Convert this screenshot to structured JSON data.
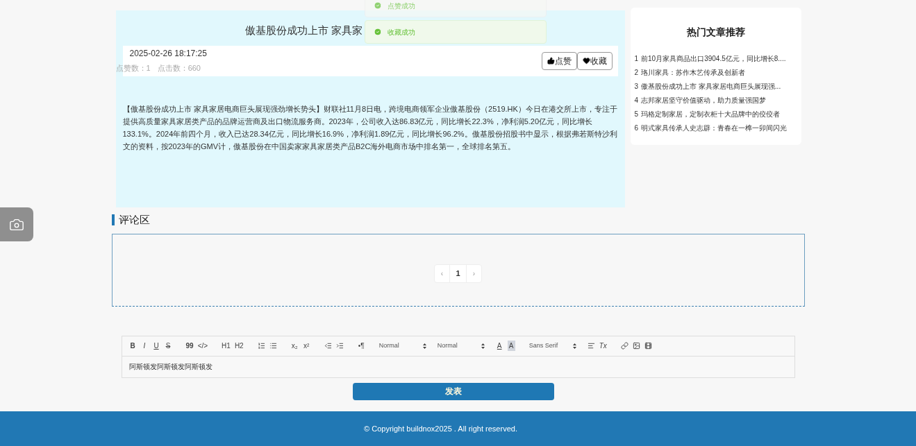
{
  "toasts": [
    {
      "text": "点赞成功",
      "faded": true
    },
    {
      "text": "收藏成功",
      "faded": false
    }
  ],
  "article": {
    "title": "傲基股份成功上市 家具家",
    "date": "2025-02-26 18:17:25",
    "likes": "点赞数：1",
    "views": "点击数：660",
    "buttons": [
      {
        "label": "点赞",
        "kind": "like"
      },
      {
        "label": "收藏",
        "kind": "favorite"
      }
    ],
    "body": "【傲基股份成功上市 家具家居电商巨头展现强劲增长势头】财联社11月8日电，跨境电商领军企业傲基股份（2519.HK）今日在港交所上市，专注于提供高质量家具家居类产品的品牌运营商及出口物流服务商。2023年，公司收入达86.83亿元，同比增长22.3%，净利润5.20亿元，同比增长133.1%。2024年前四个月，收入已达28.34亿元，同比增长16.9%，净利润1.89亿元，同比增长96.2%。傲基股份招股书中显示，根据弗若斯特沙利文的资料，按2023年的GMV计，傲基股份在中国卖家家具家居类产品B2C海外电商市场中排名第一，全球排名第五。"
  },
  "sidebar": {
    "title": "热门文章推荐",
    "items": [
      {
        "rank": "1",
        "title": "前10月家具商品出口3904.5亿元，同比增长8...."
      },
      {
        "rank": "2",
        "title": "珞川家具：苏作木艺传承及创新者"
      },
      {
        "rank": "3",
        "title": "傲基股份成功上市 家具家居电商巨头展现强..."
      },
      {
        "rank": "4",
        "title": "志邦家居坚守价值驱动，助力质量强国梦"
      },
      {
        "rank": "5",
        "title": "玛格定制家居，定制衣柜十大品牌中的佼佼者"
      },
      {
        "rank": "6",
        "title": "明式家具传承人史志辟：青春在一榫一卯间闪光"
      }
    ]
  },
  "comments": {
    "title": "评论区",
    "pagination": {
      "prev": "‹",
      "pages": [
        {
          "label": "1",
          "selected": true
        }
      ],
      "next": "›"
    }
  },
  "editor": {
    "toolbar": [
      {
        "kind": "bold",
        "label": "B"
      },
      {
        "kind": "italic",
        "label": "I"
      },
      {
        "kind": "underline",
        "label": "U"
      },
      {
        "kind": "strike",
        "label": "S"
      },
      {
        "kind": "gap"
      },
      {
        "kind": "bold",
        "label": "99"
      },
      {
        "kind": "text",
        "label": "</>"
      },
      {
        "kind": "gap"
      },
      {
        "kind": "text",
        "label": "H1"
      },
      {
        "kind": "text",
        "label": "H2"
      },
      {
        "kind": "gap"
      },
      {
        "kind": "ordered"
      },
      {
        "kind": "bullet"
      },
      {
        "kind": "gap"
      },
      {
        "kind": "text",
        "label": "x₂"
      },
      {
        "kind": "text",
        "label": "x²"
      },
      {
        "kind": "gap"
      },
      {
        "kind": "outdent"
      },
      {
        "kind": "indent"
      },
      {
        "kind": "gap"
      },
      {
        "kind": "text",
        "label": "•¶"
      },
      {
        "kind": "gap"
      },
      {
        "kind": "select",
        "label": "Normal"
      },
      {
        "kind": "select",
        "label": "Normal"
      },
      {
        "kind": "underline",
        "label": "A"
      },
      {
        "kind": "highlight",
        "label": "A"
      },
      {
        "kind": "gap"
      },
      {
        "kind": "select",
        "label": "Sans Serif"
      },
      {
        "kind": "align"
      },
      {
        "kind": "italic",
        "label": "Tx"
      },
      {
        "kind": "gap"
      },
      {
        "kind": "link"
      },
      {
        "kind": "image"
      },
      {
        "kind": "video"
      }
    ],
    "value": "阿斯顿发阿斯顿发阿斯顿发"
  },
  "submit": "发表",
  "footer": "© Copyright buildnox2025 . All right reserved."
}
